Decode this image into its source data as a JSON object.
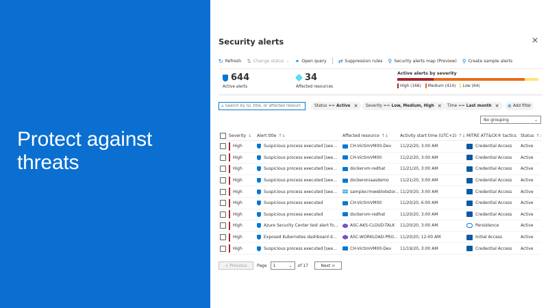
{
  "hero": {
    "line1": "Protect against",
    "line2": "threats"
  },
  "blade": {
    "title": "Security alerts",
    "close": "✕"
  },
  "commands": [
    {
      "label": "Refresh",
      "icon": "↻",
      "disabled": false
    },
    {
      "label": "Change status",
      "icon": "⇅",
      "disabled": true,
      "caret": "⌄"
    },
    {
      "label": "Open query",
      "icon": "⚭",
      "disabled": false
    },
    {
      "label": "Suppression rules",
      "icon": "⇄",
      "disabled": false
    },
    {
      "label": "Security alerts map (Preview)",
      "icon": "⚲",
      "disabled": false
    },
    {
      "label": "Create sample alerts",
      "icon": "⚲",
      "disabled": false
    }
  ],
  "stats": {
    "active_alerts": {
      "value": "644",
      "label": "Active alerts"
    },
    "affected_resources": {
      "value": "34",
      "label": "Affected resources"
    }
  },
  "severity": {
    "title": "Active alerts by severity",
    "high": {
      "label": "High (166)",
      "count": 166,
      "color": "#a4262c"
    },
    "medium": {
      "label": "Medium (414)",
      "count": 414,
      "color": "#ea6a1a"
    },
    "low": {
      "label": "Low (64)",
      "count": 64,
      "color": "#ffe27a"
    }
  },
  "filters": {
    "search_placeholder": "Search by ID, title, or affected resource",
    "pills": [
      {
        "key": "Status ==",
        "value": "Active"
      },
      {
        "key": "Severity ==",
        "value": "Low, Medium, High"
      },
      {
        "key": "Time ==",
        "value": "Last month"
      }
    ],
    "add_filter": "Add filter",
    "grouping": "No grouping"
  },
  "columns": {
    "severity": "Severity",
    "title": "Alert title",
    "resource": "Affected resource",
    "time": "Activity start time (UTC+2)",
    "tactics": "MITRE ATT&CK® tactics",
    "status": "Status"
  },
  "rows": [
    {
      "severity": "High",
      "title": "Suspicious process executed [seen ...",
      "resource": "CH-VictimVM00-Dev",
      "res_icon": "vm",
      "time": "11/22/20, 3:00 AM",
      "tactic": "Credential Access",
      "tac_icon": "tactic",
      "status": "Active"
    },
    {
      "severity": "High",
      "title": "Suspicious process executed [seen ...",
      "resource": "CH-VictimVM00",
      "res_icon": "vm",
      "time": "11/22/20, 3:00 AM",
      "tactic": "Credential Access",
      "tac_icon": "tactic",
      "status": "Active"
    },
    {
      "severity": "High",
      "title": "Suspicious process executed [seen ...",
      "resource": "dockervm-redhat",
      "res_icon": "vm",
      "time": "11/21/20, 3:00 AM",
      "tactic": "Credential Access",
      "tac_icon": "tactic",
      "status": "Active"
    },
    {
      "severity": "High",
      "title": "Suspicious process executed [seen ...",
      "resource": "dockeroniaasdemo",
      "res_icon": "vm",
      "time": "11/21/20, 3:00 AM",
      "tactic": "Credential Access",
      "tac_icon": "tactic",
      "status": "Active"
    },
    {
      "severity": "High",
      "title": "Suspicious process executed [seen ...",
      "resource": "samplecrmweblobstor...",
      "res_icon": "storage",
      "time": "11/20/20, 3:00 AM",
      "tactic": "Credential Access",
      "tac_icon": "tactic",
      "status": "Active"
    },
    {
      "severity": "High",
      "title": "Suspicious process executed",
      "resource": "CH-VictimVM00",
      "res_icon": "vm",
      "time": "11/20/20, 6:00 AM",
      "tactic": "Credential Access",
      "tac_icon": "tactic",
      "status": "Active"
    },
    {
      "severity": "High",
      "title": "Suspicious process executed",
      "resource": "dockervm-redhat",
      "res_icon": "vm",
      "time": "11/20/20, 3:00 AM",
      "tactic": "Credential Access",
      "tac_icon": "tactic",
      "status": "Active"
    },
    {
      "severity": "High",
      "title": "Azure Security Center test alert for A...",
      "resource": "ASC-AKS-CLOUD-TALK",
      "res_icon": "aks",
      "time": "11/20/20, 3:00 AM",
      "tactic": "Persistence",
      "tac_icon": "persist",
      "status": "Active"
    },
    {
      "severity": "High",
      "title": "Exposed Kubernetes dashboard det...",
      "resource": "ASC-WORKLOAD-PRO...",
      "res_icon": "aks",
      "time": "11/20/20, 12:00 AM",
      "tactic": "Initial Access",
      "tac_icon": "tactic",
      "status": "Active"
    },
    {
      "severity": "High",
      "title": "Suspicious process executed [seen ...",
      "resource": "CH-VictimVM00-Dev",
      "res_icon": "vm",
      "time": "11/19/20, 3:00 AM",
      "tactic": "Credential Access",
      "tac_icon": "tactic",
      "status": "Active"
    }
  ],
  "pager": {
    "previous": "< Previous",
    "page_label": "Page",
    "current_page": "1",
    "of_label": "of",
    "total_pages": "17",
    "next": "Next >"
  },
  "colors": {
    "brand_blue": "#0a6fd1",
    "accent": "#0078d4",
    "high": "#a4262c"
  }
}
